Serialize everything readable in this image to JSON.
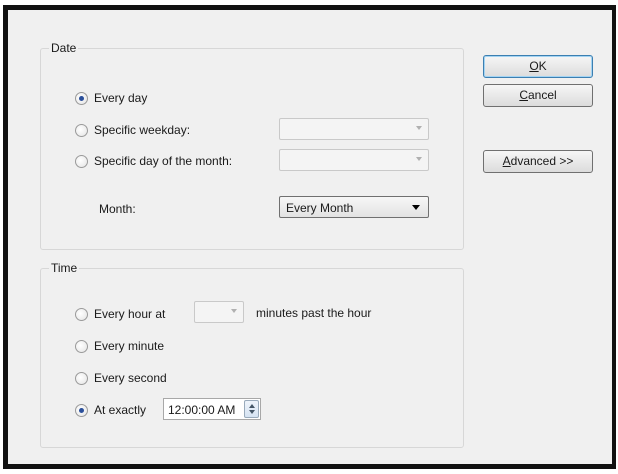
{
  "date_group": {
    "title": "Date",
    "every_day": "Every day",
    "specific_weekday": "Specific weekday:",
    "specific_day_of_month": "Specific day of the month:",
    "month_label": "Month:",
    "month_value": "Every Month"
  },
  "time_group": {
    "title": "Time",
    "every_hour_at": "Every hour at",
    "minutes_past": "minutes past the hour",
    "every_minute": "Every minute",
    "every_second": "Every second",
    "at_exactly": "At exactly",
    "time_value": "12:00:00 AM"
  },
  "buttons": {
    "ok_accel": "O",
    "ok_rest": "K",
    "cancel_accel": "C",
    "cancel_rest": "ancel",
    "advanced_accel": "A",
    "advanced_rest": "dvanced >>"
  },
  "state": {
    "date_selected": "Every day",
    "time_selected": "At exactly"
  }
}
